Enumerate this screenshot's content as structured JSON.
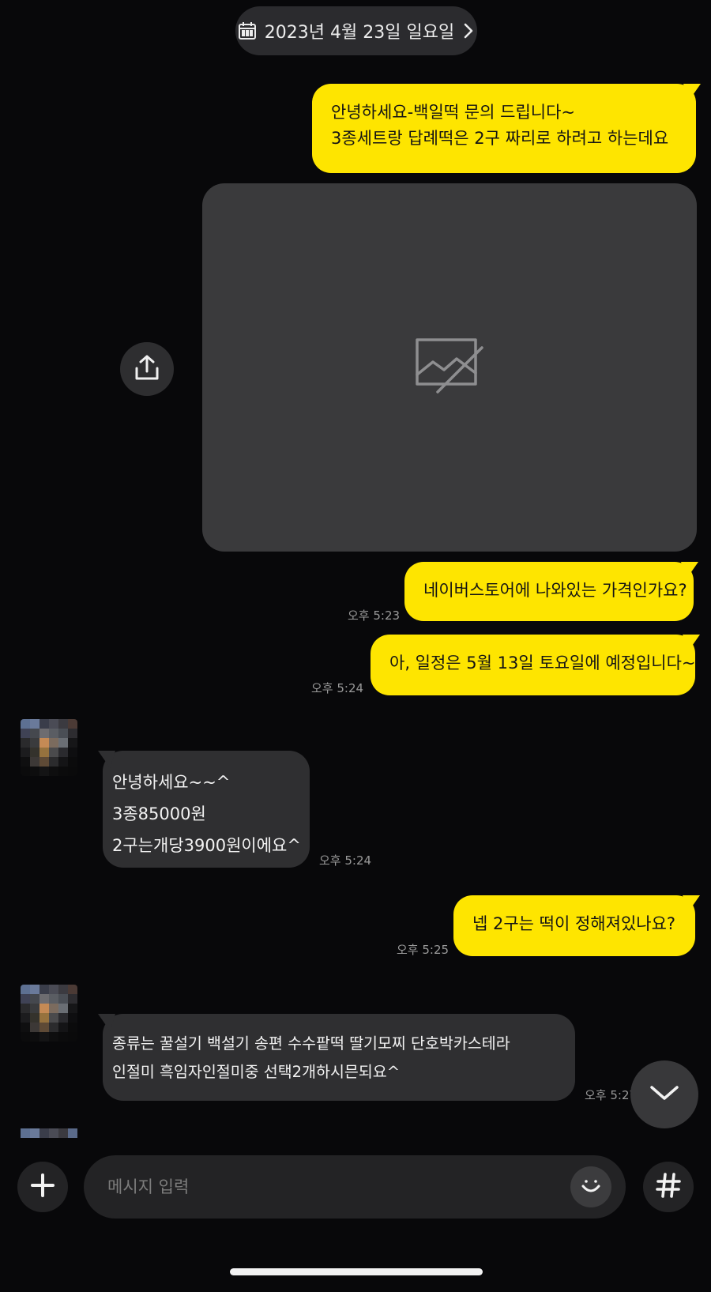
{
  "header": {
    "date_label": "2023년 4월 23일 일요일"
  },
  "messages": {
    "m1": {
      "line1": "안녕하세요-백일떡 문의 드립니다~",
      "line2": "3종세트랑 답례떡은 2구 짜리로 하려고 하는데요"
    },
    "m3": {
      "text": "네이버스토어에 나와있는 가격인가요?",
      "time": "오후 5:23"
    },
    "m4": {
      "text": "아, 일정은 5월 13일 토요일에 예정입니다~",
      "time": "오후 5:24"
    },
    "r1": {
      "line1": "안녕하세요~~^",
      "line2": "3종85000원",
      "line3": "2구는개당3900원이에요^",
      "time": "오후 5:24"
    },
    "m5": {
      "text": "넵 2구는 떡이 정해져있나요?",
      "time": "오후 5:25"
    },
    "r2": {
      "line1": "종류는  꿀설기 백설기 송편 수수팥떡 딸기모찌   단호박카스테라",
      "line2": "인절미  흑임자인절미중  선택2개하시믄되요^",
      "time": "오후 5:27"
    }
  },
  "composer": {
    "placeholder": "메시지 입력"
  },
  "icons": {
    "calendar": "calendar-icon",
    "chevron": "chevron-right-icon",
    "image_placeholder": "broken-image-icon",
    "share": "share-icon",
    "scroll": "chevron-down-icon",
    "add": "plus-icon",
    "emoji": "smiley-icon",
    "hash": "hashtag-icon"
  },
  "colors": {
    "my_bubble": "#fee500",
    "their_bubble": "#2f2f31",
    "background": "#08080a"
  }
}
